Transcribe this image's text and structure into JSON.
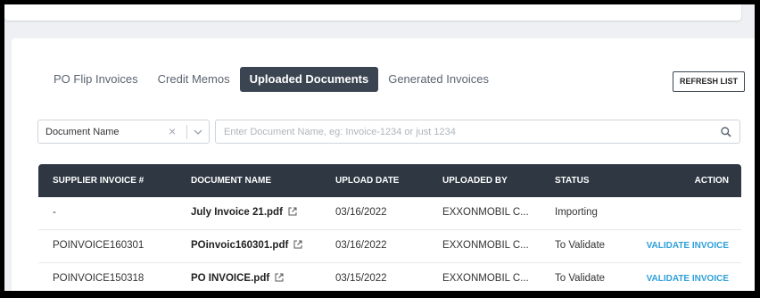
{
  "tabs": [
    {
      "label": "PO Flip Invoices",
      "active": false
    },
    {
      "label": "Credit Memos",
      "active": false
    },
    {
      "label": "Uploaded Documents",
      "active": true
    },
    {
      "label": "Generated Invoices",
      "active": false
    }
  ],
  "refresh_label": "REFRESH LIST",
  "filter": {
    "selected": "Document Name",
    "clear_icon": "close-icon",
    "dropdown_icon": "chevron-down-icon"
  },
  "search": {
    "placeholder": "Enter Document Name, eg: Invoice-1234 or just 1234",
    "value": "",
    "icon": "search-icon"
  },
  "table": {
    "columns": {
      "supplier_invoice": "SUPPLIER INVOICE #",
      "document_name": "DOCUMENT NAME",
      "upload_date": "UPLOAD DATE",
      "uploaded_by": "UPLOADED BY",
      "status": "STATUS",
      "action": "ACTION"
    },
    "rows": [
      {
        "supplier_invoice": "-",
        "document_name": "July Invoice 21.pdf",
        "upload_date": "03/16/2022",
        "uploaded_by": "EXXONMOBIL C...",
        "status": "Importing",
        "action": ""
      },
      {
        "supplier_invoice": "POINVOICE160301",
        "document_name": "POinvoic160301.pdf",
        "upload_date": "03/16/2022",
        "uploaded_by": "EXXONMOBIL C...",
        "status": "To Validate",
        "action": "VALIDATE INVOICE"
      },
      {
        "supplier_invoice": "POINVOICE150318",
        "document_name": "PO INVOICE.pdf",
        "upload_date": "03/15/2022",
        "uploaded_by": "EXXONMOBIL C...",
        "status": "To Validate",
        "action": "VALIDATE INVOICE"
      }
    ]
  },
  "colors": {
    "active_tab_bg": "#3b4552",
    "table_header_bg": "#2e3742",
    "action_link": "#2d9fd9",
    "page_bg": "#eef0f3"
  }
}
